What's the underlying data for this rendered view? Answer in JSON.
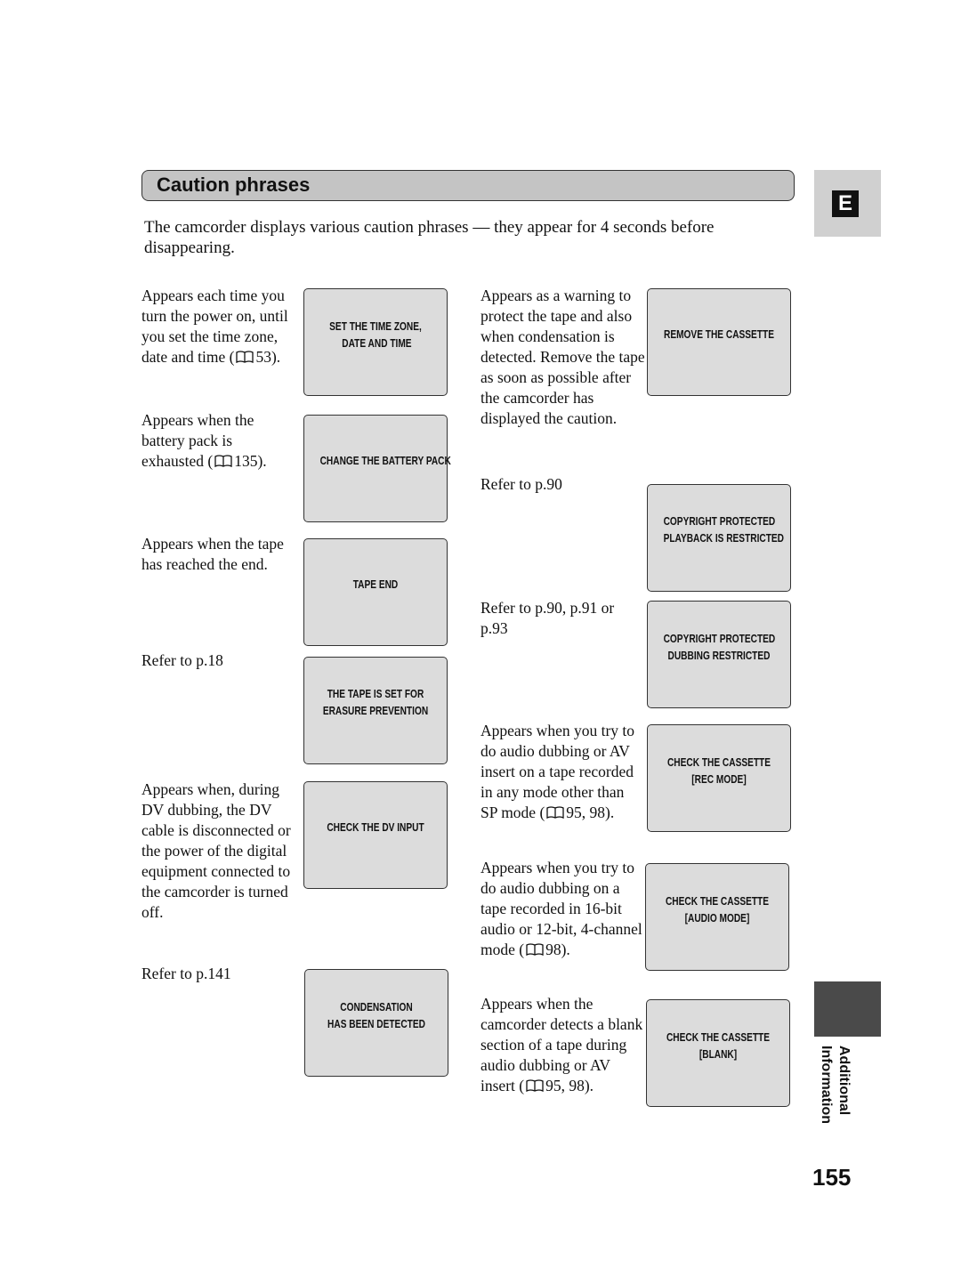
{
  "header": {
    "title": "Caution phrases",
    "language_tab": "E"
  },
  "intro": "The camcorder displays various caution phrases — they appear for 4 seconds before disappearing.",
  "left_column": {
    "descriptions": [
      {
        "pre": "Appears each time you turn the power on, until you set the time zone, date and time (",
        "ref": "53",
        "post": ")."
      },
      {
        "pre": "Appears when the battery pack is exhausted (",
        "ref": "135",
        "post": ")."
      },
      {
        "pre": "Appears when the tape has reached the end.",
        "ref": "",
        "post": ""
      },
      {
        "pre": "Refer to p.18",
        "ref": "",
        "post": ""
      },
      {
        "pre": "Appears when, during DV dubbing, the DV cable is disconnected or the power of the digital equipment connected to the camcorder is turned off.",
        "ref": "",
        "post": ""
      },
      {
        "pre": "Refer to p.141",
        "ref": "",
        "post": ""
      }
    ],
    "screens": [
      "SET THE TIME ZONE,\n DATE AND TIME",
      "CHANGE THE BATTERY PACK",
      "TAPE END",
      "THE TAPE IS SET FOR\nERASURE PREVENTION",
      "CHECK THE DV INPUT",
      "CONDENSATION\nHAS BEEN DETECTED"
    ]
  },
  "right_column": {
    "descriptions": [
      {
        "pre": "Appears as a warning to protect the tape and also when condensation is detected. Remove the tape as soon as possible after the camcorder has displayed the caution.",
        "ref": "",
        "post": ""
      },
      {
        "pre": "Refer to p.90",
        "ref": "",
        "post": ""
      },
      {
        "pre": "Refer to p.90, p.91 or p.93",
        "ref": "",
        "post": ""
      },
      {
        "pre": "Appears when you try to do audio dubbing or AV insert on a tape recorded in any mode other than SP mode (",
        "ref": "95, 98",
        "post": ")."
      },
      {
        "pre": "Appears when you try to do audio dubbing on a tape recorded in 16-bit audio or 12-bit, 4-channel mode (",
        "ref": "98",
        "post": ")."
      },
      {
        "pre": "Appears when the camcorder detects a blank section of a tape during audio dubbing or AV insert (",
        "ref": "95, 98",
        "post": ")."
      }
    ],
    "screens": [
      "REMOVE THE CASSETTE",
      "COPYRIGHT PROTECTED\nPLAYBACK IS RESTRICTED",
      "COPYRIGHT PROTECTED\nDUBBING RESTRICTED",
      "CHECK THE CASSETTE\n[REC MODE]",
      "CHECK THE CASSETTE\n[AUDIO MODE]",
      "CHECK THE CASSETTE\n[BLANK]"
    ]
  },
  "section": {
    "line1": "Additional",
    "line2": "Information"
  },
  "page_number": "155"
}
